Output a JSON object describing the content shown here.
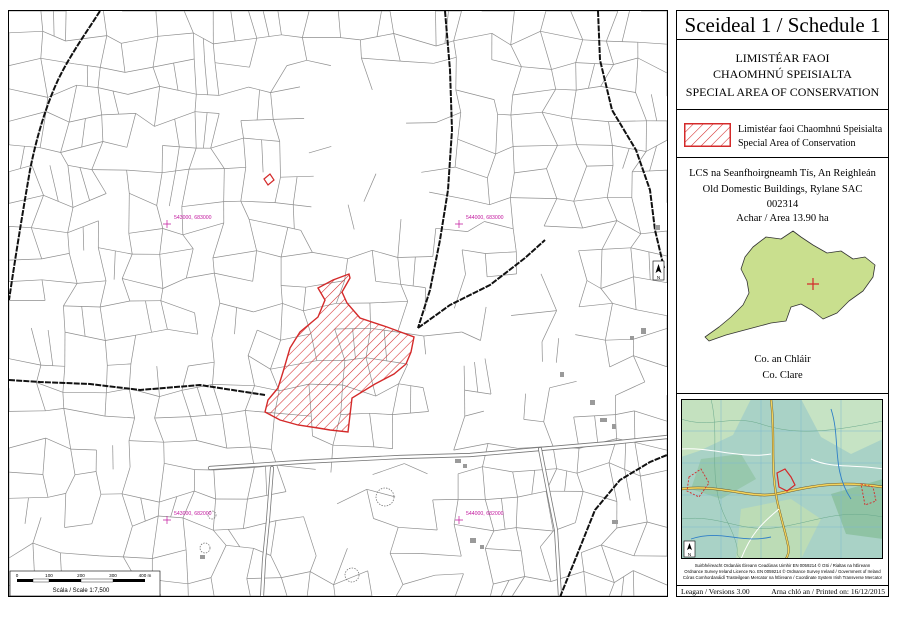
{
  "panel": {
    "title": "Sceideal 1 / Schedule 1",
    "designation": [
      "LIMISTÉAR FAOI",
      "CHAOMHNÚ SPEISIALTA",
      "SPECIAL AREA OF CONSERVATION"
    ],
    "legend": {
      "label_ga": "Limistéar faoi Chaomhnú Speisialta",
      "label_en": "Special Area of Conservation"
    },
    "site": {
      "name_ga": "LCS na Seanfhoirgneamh Tís, An Reighleán",
      "name_en": "Old Domestic Buildings, Rylane SAC",
      "code": "002314",
      "area": "Achar / Area 13.90 ha"
    },
    "county": {
      "name_ga": "Co. an Chláir",
      "name_en": "Co. Clare"
    },
    "copyright": [
      "Suirbhéireacht Ordanáis Éireann Ceadúnas Uimhir EN 0059214 © OSi / Rialtas na hÉireann",
      "Ordnance Survey Ireland Licence No. EN 0059214 © Ordnance Survey Ireland / Government of Ireland",
      "Córas Comhordanáidí Trasteilgean Mercator na hÉireann / Coordinate System Irish Transverse Mercator"
    ],
    "footer": {
      "version": "Leagan / Versions 3.00",
      "printed": "Arna chló an / Printed on: 16/12/2015"
    }
  },
  "map": {
    "grid_labels": [
      "543000, 683000",
      "544000, 683000",
      "543000, 682000",
      "544000, 682000"
    ],
    "scale": {
      "ticks": [
        "0",
        "100",
        "200",
        "300",
        "400 m"
      ],
      "label": "Scála / Scale 1:7,500"
    },
    "north_label": "N"
  },
  "colors": {
    "sac": "#d42a2a",
    "grid_label": "#c2189e",
    "county_fill": "#c9df8e",
    "location_cross": "#d42a2a"
  },
  "icons": {
    "map_north": "north-arrow-icon",
    "inset_north": "north-arrow-icon",
    "location": "location-cross-icon"
  }
}
